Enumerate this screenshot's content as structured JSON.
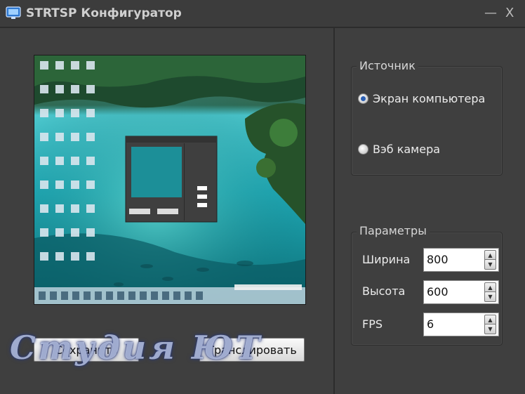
{
  "window": {
    "title": "STRTSP Конфигуратор",
    "minimize_glyph": "—",
    "close_glyph": "X"
  },
  "buttons": {
    "save_label": "Сохранить",
    "broadcast_label": "Транслировать"
  },
  "source": {
    "legend": "Источник",
    "options": [
      {
        "label": "Экран компьютера",
        "selected": true
      },
      {
        "label": "Вэб камера",
        "selected": false
      }
    ]
  },
  "params": {
    "legend": "Параметры",
    "width": {
      "label": "Ширина",
      "value": "800"
    },
    "height": {
      "label": "Высота",
      "value": "600"
    },
    "fps": {
      "label": "FPS",
      "value": "6"
    }
  },
  "watermark": "Студия ЮТ",
  "colors": {
    "background": "#3f3f3f",
    "accent": "#2b5fb3"
  }
}
